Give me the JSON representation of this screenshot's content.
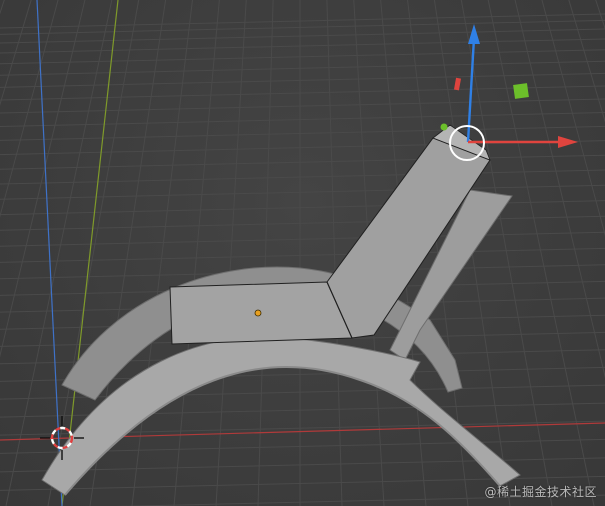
{
  "watermark": "@稀土掘金技术社区",
  "colors": {
    "background": "#3d3d3d",
    "grid": "#4a4a4a",
    "x_axis": "#b03a3a",
    "y_axis": "#7f9a2a",
    "z_axis": "#3f72c8",
    "gizmo_red": "#e0443e",
    "gizmo_blue": "#2f80e6",
    "gizmo_green": "#6cbf2a",
    "object": "#a6a6a6",
    "object_shadow": "#7d7d7d",
    "origin_dot": "#e8a020"
  },
  "icons": [
    "3d-cursor-icon",
    "transform-gizmo-icon",
    "object-origin-icon"
  ]
}
